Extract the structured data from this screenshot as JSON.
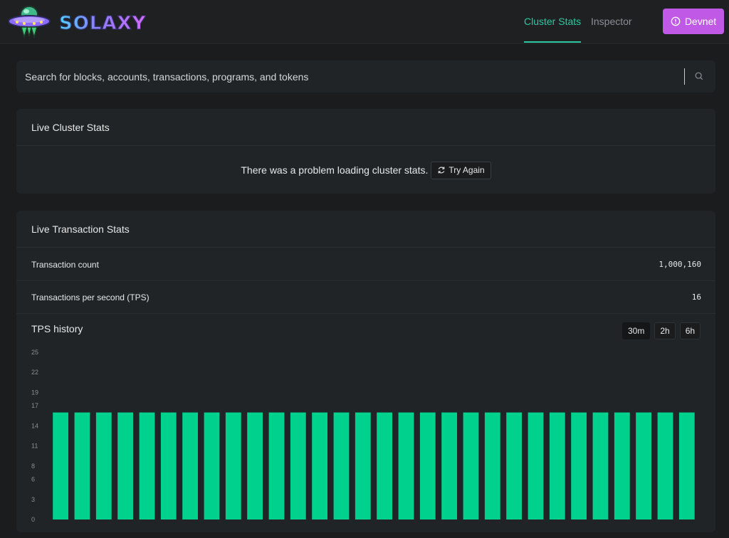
{
  "header": {
    "brand": "SOLAXY",
    "nav": [
      {
        "label": "Cluster Stats",
        "active": true
      },
      {
        "label": "Inspector",
        "active": false
      }
    ],
    "network_button": "Devnet"
  },
  "search": {
    "placeholder": "Search for blocks, accounts, transactions, programs, and tokens"
  },
  "cluster_stats": {
    "title": "Live Cluster Stats",
    "error_message": "There was a problem loading cluster stats.",
    "retry_label": "Try Again"
  },
  "transaction_stats": {
    "title": "Live Transaction Stats",
    "rows": [
      {
        "label": "Transaction count",
        "value": "1,000,160"
      },
      {
        "label": "Transactions per second (TPS)",
        "value": "16"
      }
    ],
    "tps_history": {
      "title": "TPS history",
      "ranges": [
        "30m",
        "2h",
        "6h"
      ],
      "active_range": "30m"
    }
  },
  "colors": {
    "accent": "#2ec9a2",
    "bar": "#00d18c",
    "network_button": "#c059e6",
    "background": "#1a1c1e",
    "card": "#212426"
  },
  "chart_data": {
    "type": "bar",
    "title": "TPS history",
    "y_ticks": [
      0,
      3,
      6,
      8,
      11,
      14,
      17,
      19,
      22,
      25
    ],
    "ylim": [
      0,
      25
    ],
    "grid": false,
    "values": [
      16,
      16,
      16,
      16,
      16,
      16,
      16,
      16,
      16,
      16,
      16,
      16,
      16,
      16,
      16,
      16,
      16,
      16,
      16,
      16,
      16,
      16,
      16,
      16,
      16,
      16,
      16,
      16,
      16,
      16
    ]
  }
}
